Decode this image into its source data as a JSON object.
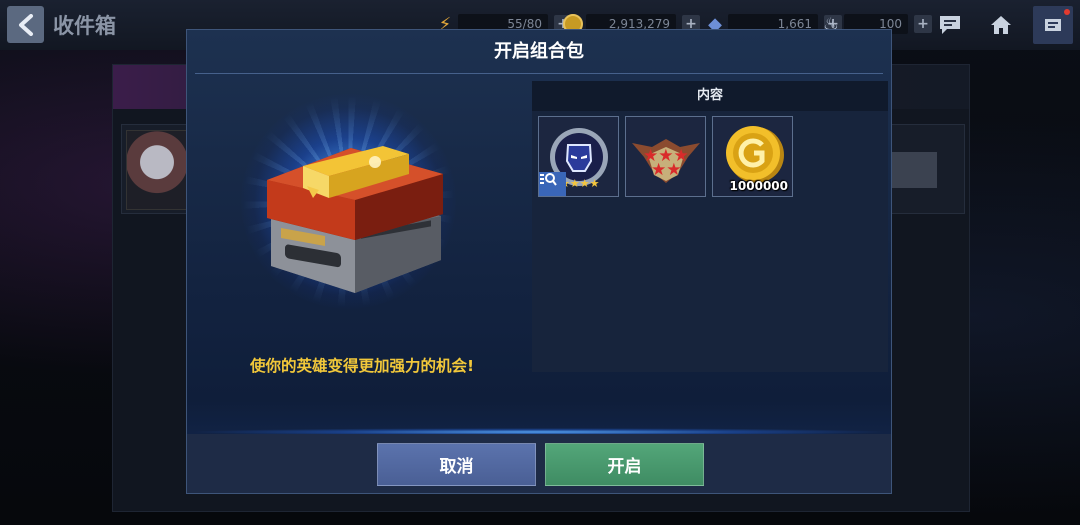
{
  "screen": {
    "title": "收件箱",
    "resources": [
      {
        "icon": "energy-icon",
        "value": "55/80"
      },
      {
        "icon": "gold-coin-icon",
        "value": "2,913,279"
      },
      {
        "icon": "crystal-icon",
        "value": "1,661"
      },
      {
        "icon": "flame-icon",
        "value": "100"
      }
    ],
    "plus_label": "+"
  },
  "dialog": {
    "title": "开启组合包",
    "promo_text": "使你的英雄变得更加强力的机会!",
    "contents_header": "内容",
    "items": [
      {
        "icon": "hero-emblem-icon"
      },
      {
        "icon": "rank-stars-icon"
      },
      {
        "icon": "gold-coin-icon",
        "quantity": "1000000"
      }
    ],
    "buttons": {
      "cancel": "取消",
      "open": "开启"
    }
  },
  "colors": {
    "promo_text": "#f2c83a",
    "cancel_button": "#5269a3",
    "open_button": "#4a9a6e",
    "dialog_bg": "#172a49"
  }
}
